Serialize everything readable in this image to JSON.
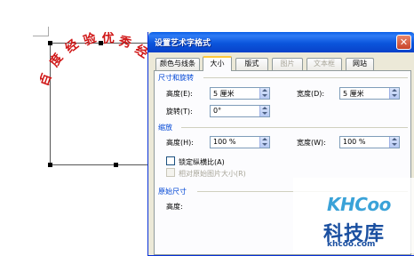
{
  "document": {
    "wordart_chars": [
      "百",
      "度",
      "经",
      "验",
      "优",
      "秀",
      "经"
    ]
  },
  "dialog": {
    "title": "设置艺术字格式",
    "close_glyph": "✕",
    "tabs": [
      {
        "label": "颜色与线条",
        "state": "normal"
      },
      {
        "label": "大小",
        "state": "active"
      },
      {
        "label": "版式",
        "state": "normal"
      },
      {
        "label": "图片",
        "state": "disabled"
      },
      {
        "label": "文本框",
        "state": "disabled"
      },
      {
        "label": "网站",
        "state": "normal"
      }
    ],
    "size_rotate": {
      "section_title": "尺寸和旋转",
      "height_label": "高度(E):",
      "height_value": "5 厘米",
      "width_label": "宽度(D):",
      "width_value": "5 厘米",
      "rotate_label": "旋转(T):",
      "rotate_value": "0°"
    },
    "scale": {
      "section_title": "缩放",
      "height_label": "高度(H):",
      "height_value": "100 %",
      "width_label": "宽度(W):",
      "width_value": "100 %",
      "lock_aspect_label": "锁定纵横比(A)",
      "lock_aspect_checked": false,
      "relative_label": "相对原始图片大小(R)",
      "relative_checked": false
    },
    "original": {
      "section_title": "原始尺寸",
      "height_label": "高度:"
    }
  },
  "watermark": {
    "logo": "KHCoo",
    "cn": "科技库",
    "url": "khcoo.com"
  },
  "colors": {
    "wordart_red": "#d01818",
    "titlebar_blue": "#0b55dc",
    "section_blue": "#0046d5",
    "dialog_bg": "#ece9d8"
  }
}
